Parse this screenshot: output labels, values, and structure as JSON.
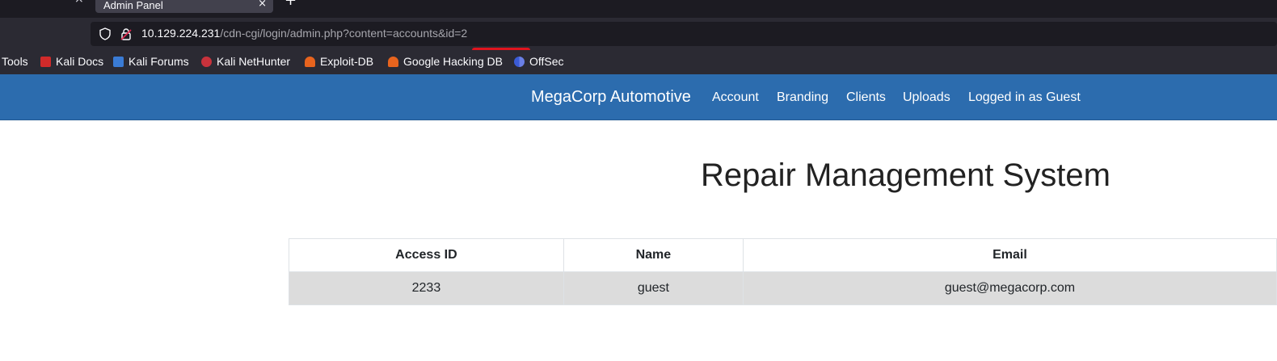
{
  "browser": {
    "tab_title": "Admin Panel",
    "tab_close": "×",
    "left_close": "×",
    "new_tab": "+",
    "url_host": "10.129.224.231",
    "url_path": "/cdn-cgi/login/admin.php?content=accounts&id=2",
    "bookmarks": [
      {
        "label": "Tools",
        "icon": "none"
      },
      {
        "label": "Kali Docs",
        "icon": "kali-docs-icon"
      },
      {
        "label": "Kali Forums",
        "icon": "kali-forums-icon"
      },
      {
        "label": "Kali NetHunter",
        "icon": "kali-nethunter-icon"
      },
      {
        "label": "Exploit-DB",
        "icon": "exploit-db-icon"
      },
      {
        "label": "Google Hacking DB",
        "icon": "ghdb-icon"
      },
      {
        "label": "OffSec",
        "icon": "offsec-icon"
      }
    ]
  },
  "site": {
    "brand": "MegaCorp Automotive",
    "nav": [
      "Account",
      "Branding",
      "Clients",
      "Uploads",
      "Logged in as Guest"
    ],
    "title": "Repair Management System",
    "table": {
      "headers": [
        "Access ID",
        "Name",
        "Email"
      ],
      "rows": [
        [
          "2233",
          "guest",
          "guest@megacorp.com"
        ]
      ]
    }
  },
  "colors": {
    "navbar": "#2c6cae",
    "row_bg": "#dcdcdc",
    "url_marker": "#e0141e"
  }
}
